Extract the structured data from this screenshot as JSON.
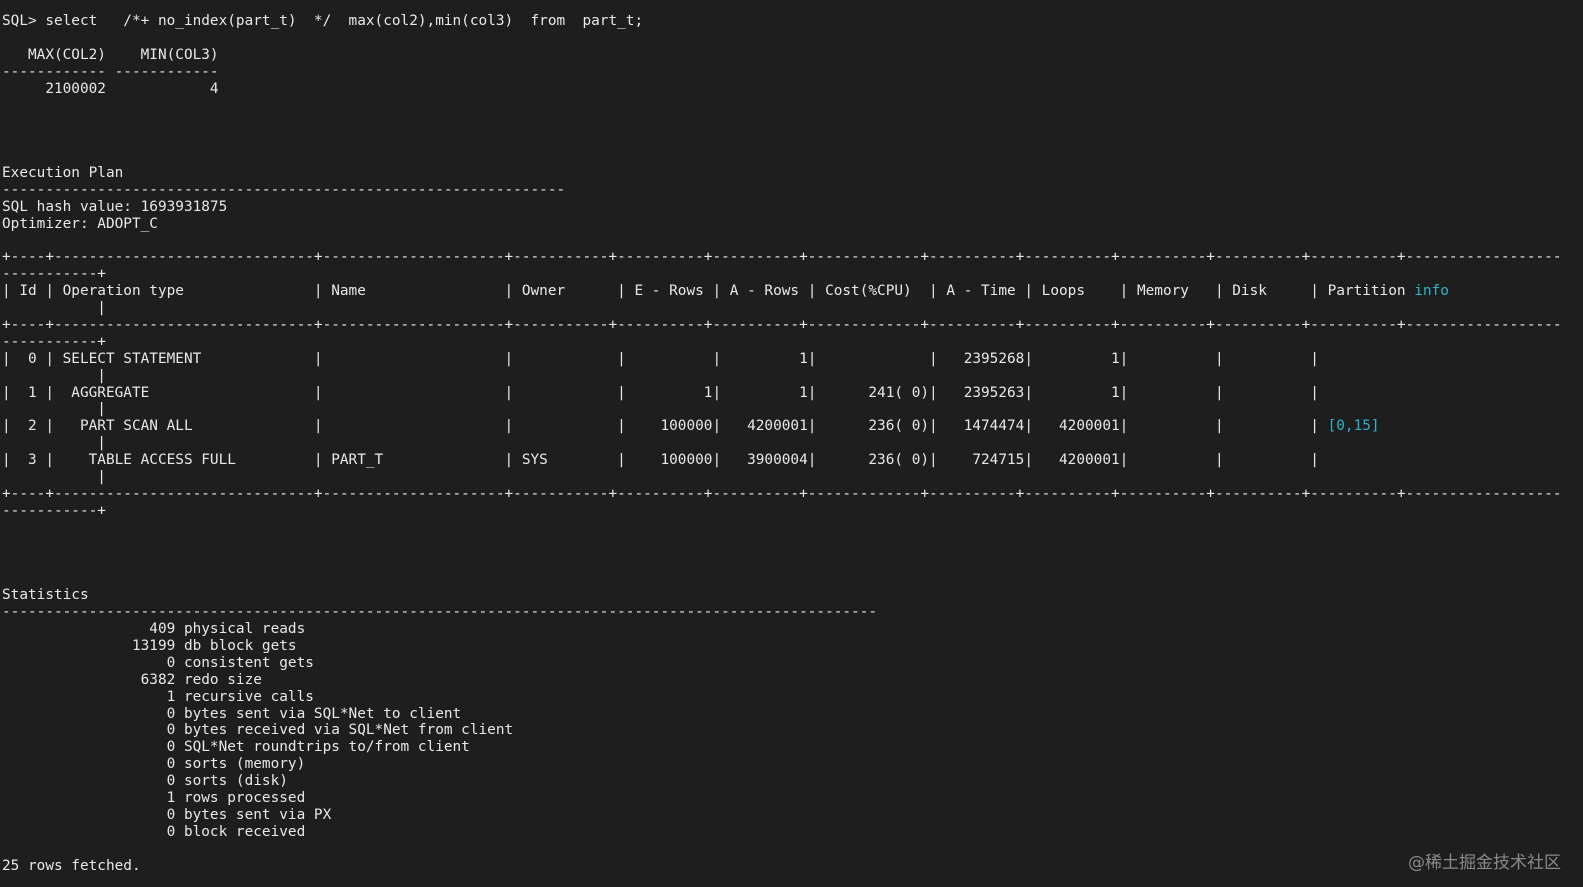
{
  "terminal": {
    "lines": [
      "SQL> select   /*+ no_index(part_t)  */  max(col2),min(col3)  from  part_t;",
      "",
      "   MAX(COL2)    MIN(COL3)",
      "------------ ------------",
      "     2100002            4",
      "",
      "",
      "",
      "",
      "Execution Plan",
      "-----------------------------------------------------------------",
      "SQL hash value: 1693931875",
      "Optimizer: ADOPT_C",
      "",
      "+----+------------------------------+---------------------+-----------+----------+----------+-------------+----------+----------+----------+----------+----------+------------------",
      "-----------+",
      "| Id | Operation type               | Name                | Owner      | E - Rows | A - Rows | Cost(%CPU)  | A - Time | Loops    | Memory   | Disk     | Partition info",
      "           |",
      "+----+------------------------------+---------------------+-----------+----------+----------+-------------+----------+----------+----------+----------+----------+------------------",
      "-----------+",
      "|  0 | SELECT STATEMENT             |                     |            |          |         1|             |   2395268|         1|          |          |",
      "           |",
      "|  1 |  AGGREGATE                   |                     |            |         1|         1|      241( 0)|   2395263|         1|          |          |",
      "           |",
      "|  2 |   PART SCAN ALL              |                     |            |    100000|   4200001|      236( 0)|   1474474|   4200001|          |          | [0,15]",
      "           |",
      "|  3 |    TABLE ACCESS FULL         | PART_T              | SYS        |    100000|   3900004|      236( 0)|    724715|   4200001|          |          |",
      "           |",
      "+----+------------------------------+---------------------+-----------+----------+----------+-------------+----------+----------+----------+----------+----------+------------------",
      "-----------+",
      "",
      "",
      "",
      "",
      "Statistics",
      "-----------------------------------------------------------------------------------------------------",
      "                 409 physical reads",
      "               13199 db block gets",
      "                   0 consistent gets",
      "                6382 redo size",
      "                   1 recursive calls",
      "                   0 bytes sent via SQL*Net to client",
      "                   0 bytes received via SQL*Net from client",
      "                   0 SQL*Net roundtrips to/from client",
      "                   0 sorts (memory)",
      "                   0 sorts (disk)",
      "                   1 rows processed",
      "                   0 bytes sent via PX",
      "                   0 block received",
      "",
      "25 rows fetched."
    ],
    "highlights": [
      "info",
      "[0,15]"
    ],
    "highlight_color": "#2fb3c8",
    "text_color": "#e8e8e8",
    "background_color": "#1e1e1e"
  },
  "watermark": "@稀土掘金技术社区"
}
